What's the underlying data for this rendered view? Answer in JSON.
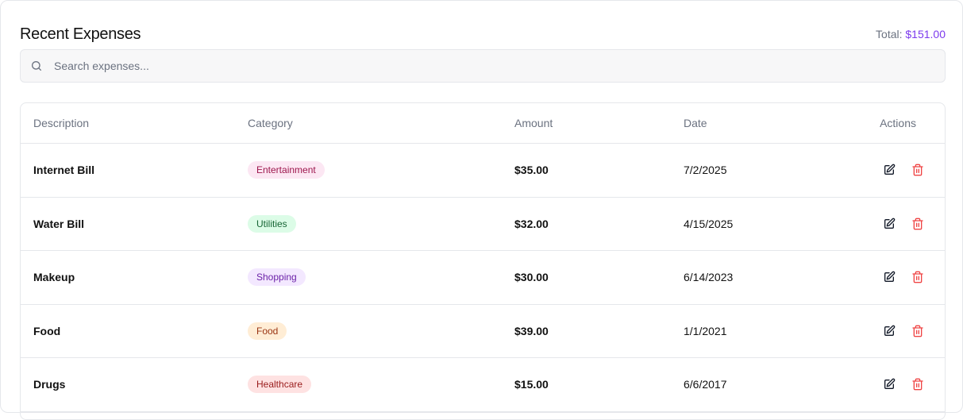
{
  "header": {
    "title": "Recent Expenses",
    "total_label": "Total:",
    "total_value": "$151.00"
  },
  "search": {
    "placeholder": "Search expenses...",
    "value": ""
  },
  "table": {
    "columns": [
      "Description",
      "Category",
      "Amount",
      "Date",
      "Actions"
    ],
    "rows": [
      {
        "description": "Internet Bill",
        "category": "Entertainment",
        "amount": "$35.00",
        "date": "7/2/2025"
      },
      {
        "description": "Water Bill",
        "category": "Utilities",
        "amount": "$32.00",
        "date": "4/15/2025"
      },
      {
        "description": "Makeup",
        "category": "Shopping",
        "amount": "$30.00",
        "date": "6/14/2023"
      },
      {
        "description": "Food",
        "category": "Food",
        "amount": "$39.00",
        "date": "1/1/2021"
      },
      {
        "description": "Drugs",
        "category": "Healthcare",
        "amount": "$15.00",
        "date": "6/6/2017"
      }
    ]
  },
  "colors": {
    "accent": "#7c3aed",
    "delete": "#ef4444",
    "categories": {
      "Entertainment": {
        "bg": "#fce7f3",
        "fg": "#9d174d"
      },
      "Utilities": {
        "bg": "#dcfce7",
        "fg": "#166534"
      },
      "Shopping": {
        "bg": "#f3e8ff",
        "fg": "#6b21a8"
      },
      "Food": {
        "bg": "#ffedd5",
        "fg": "#9a3412"
      },
      "Healthcare": {
        "bg": "#fee2e2",
        "fg": "#991b1b"
      }
    }
  },
  "icons": {
    "search": "search-icon",
    "edit": "edit-icon",
    "delete": "trash-icon"
  }
}
